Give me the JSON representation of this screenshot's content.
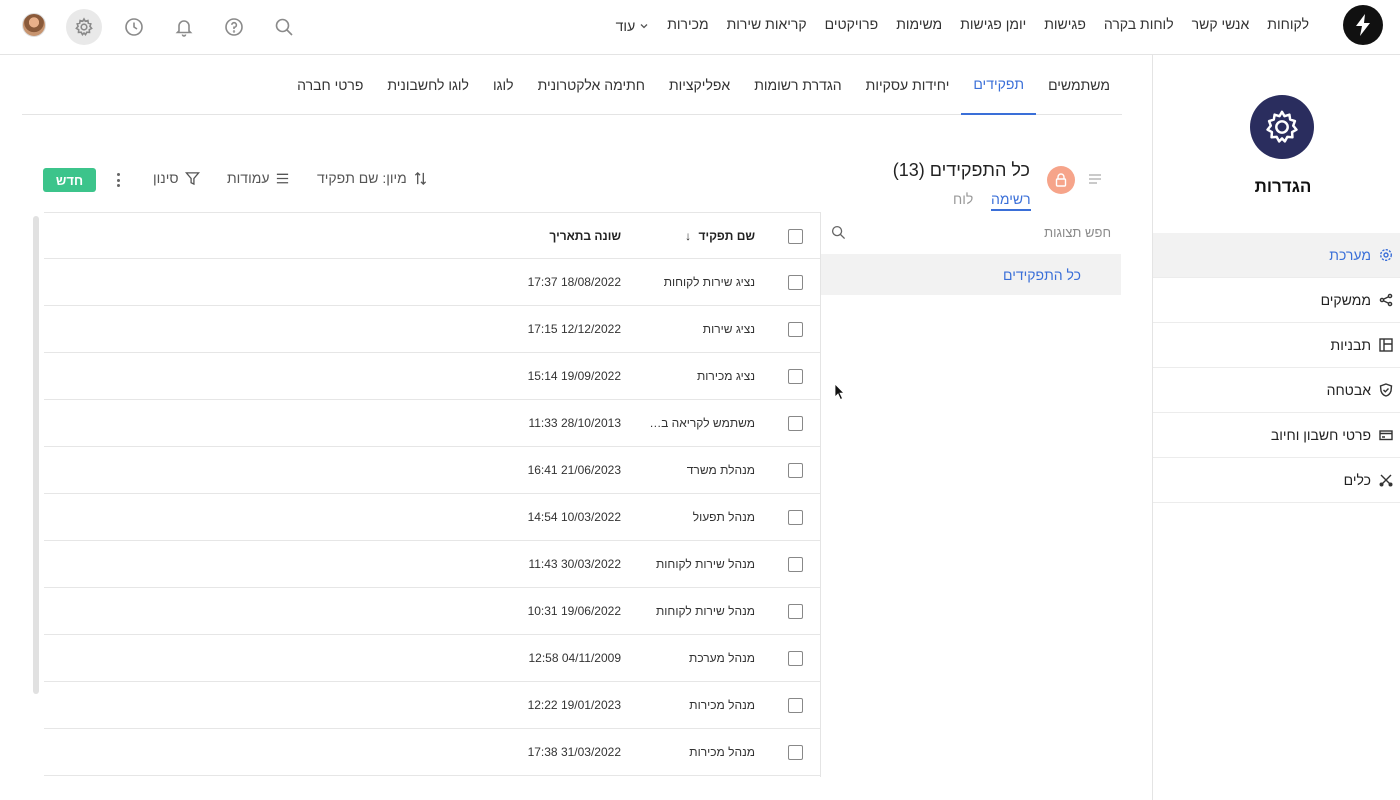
{
  "topnav": {
    "items": [
      "לקוחות",
      "אנשי קשר",
      "לוחות בקרה",
      "פגישות",
      "יומן פגישות",
      "משימות",
      "פרויקטים",
      "קריאות שירות",
      "מכירות"
    ],
    "more_label": "עוד"
  },
  "sidebar": {
    "title": "הגדרות",
    "items": [
      {
        "label": "מערכת",
        "icon": "gear-icon"
      },
      {
        "label": "ממשקים",
        "icon": "share-icon"
      },
      {
        "label": "תבניות",
        "icon": "layout-icon"
      },
      {
        "label": "אבטחה",
        "icon": "shield-icon"
      },
      {
        "label": "פרטי חשבון וחיוב",
        "icon": "card-icon"
      },
      {
        "label": "כלים",
        "icon": "tools-icon"
      }
    ]
  },
  "tabs": [
    "משתמשים",
    "תפקידים",
    "יחידות עסקיות",
    "הגדרת רשומות",
    "אפליקציות",
    "חתימה אלקטרונית",
    "לוגו",
    "לוגו לחשבונית",
    "פרטי חברה"
  ],
  "list": {
    "title": "כל התפקידים  (13)",
    "view_list": "רשימה",
    "view_board": "לוח",
    "sort_label": "מיון: שם תפקיד",
    "columns_label": "עמודות",
    "filter_label": "סינון",
    "new_label": "חדש"
  },
  "filter_panel": {
    "search_placeholder": "חפש תצוגות",
    "all_label": "כל התפקידים"
  },
  "table": {
    "headers": {
      "name": "שם תפקיד",
      "date": "שונה בתאריך"
    },
    "rows": [
      {
        "name": "נציג שירות לקוחות",
        "date": "17:37 18/08/2022"
      },
      {
        "name": "נציג שירות",
        "date": "17:15 12/12/2022"
      },
      {
        "name": "נציג מכירות",
        "date": "15:14 19/09/2022"
      },
      {
        "name": "משתמש לקריאה בלבד",
        "date": "11:33 28/10/2013"
      },
      {
        "name": "מנהלת משרד",
        "date": "16:41 21/06/2023"
      },
      {
        "name": "מנהל תפעול",
        "date": "14:54 10/03/2022"
      },
      {
        "name": "מנהל שירות לקוחות",
        "date": "11:43 30/03/2022"
      },
      {
        "name": "מנהל שירות לקוחות",
        "date": "10:31 19/06/2022"
      },
      {
        "name": "מנהל מערכת",
        "date": "12:58 04/11/2009"
      },
      {
        "name": "מנהל מכירות",
        "date": "12:22 19/01/2023"
      },
      {
        "name": "מנהל מכירות",
        "date": "17:38 31/03/2022"
      }
    ]
  },
  "colors": {
    "accent": "#3a6fd8",
    "new_button": "#3cc48b",
    "settings_badge": "#2a2d5e",
    "lock_badge": "#f6a48a"
  }
}
